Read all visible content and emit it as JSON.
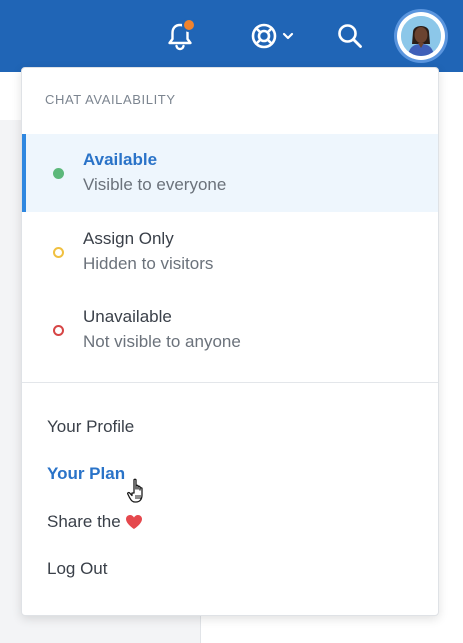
{
  "topbar": {
    "bell": {
      "icon": "bell-icon",
      "has_notification": true,
      "notification_color": "#f0832e"
    },
    "help": {
      "icon": "lifebuoy-icon",
      "dropdown_icon": "chevron-down-icon"
    },
    "search": {
      "icon": "search-icon"
    },
    "avatar": {
      "icon": "user-avatar"
    },
    "bar_color": "#2065b6"
  },
  "dropdown": {
    "section_title": "CHAT AVAILABILITY",
    "statuses": [
      {
        "name": "Available",
        "description": "Visible to everyone",
        "dot_color": "#5cb87a",
        "selected": true
      },
      {
        "name": "Assign Only",
        "description": "Hidden to visitors",
        "dot_color": "#f0c040",
        "selected": false
      },
      {
        "name": "Unavailable",
        "description": "Not visible to anyone",
        "dot_color": "#d64545",
        "selected": false
      }
    ],
    "links": [
      {
        "label": "Your Profile"
      },
      {
        "label": "Your Plan",
        "current": true
      },
      {
        "label": "Share the",
        "icon": "heart-icon",
        "icon_color": "#e5484d"
      },
      {
        "label": "Log Out"
      }
    ],
    "accent_color": "#2a73c8"
  }
}
